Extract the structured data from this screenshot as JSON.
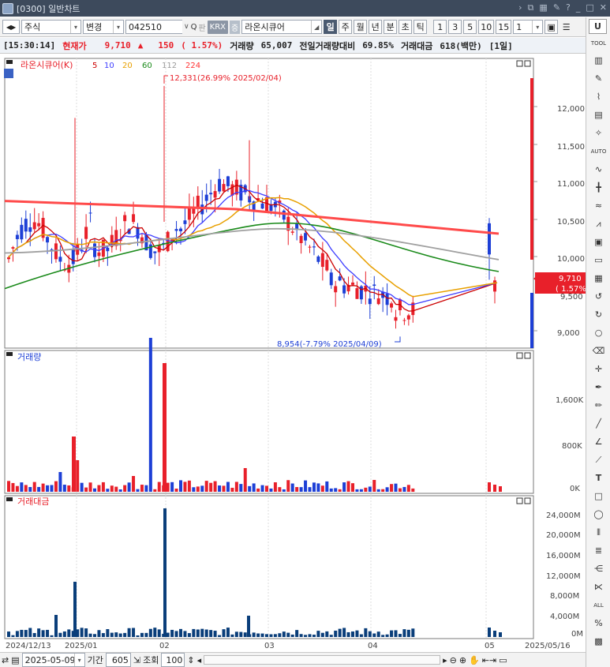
{
  "window": {
    "title": "[0300] 일반차트"
  },
  "toolbar": {
    "market": "주식",
    "mode": "변경",
    "code": "042510",
    "search": "Q",
    "kr": "판",
    "exchange": "KRX",
    "exch2": "증",
    "name": "라온시큐어",
    "periods": [
      "일",
      "주",
      "월",
      "년",
      "분",
      "초",
      "틱"
    ],
    "selected_period": "일",
    "intervals": [
      "1",
      "3",
      "5",
      "10",
      "15"
    ],
    "interval_value": "1"
  },
  "info": {
    "time": "[15:30:14]",
    "price_label": "현재가",
    "price": "9,710",
    "arrow": "▲",
    "change": "150",
    "pct": "( 1.57%)",
    "vol_label": "거래량",
    "vol": "65,007",
    "prevvol_label": "전일거래량대비",
    "prevvol": "69.85%",
    "amt_label": "거래대금",
    "amt": "618(백만)",
    "period": "[1일]"
  },
  "price_panel": {
    "legend_name": "라온시큐어(K)",
    "ma": [
      {
        "label": "5",
        "color": "#cc0000"
      },
      {
        "label": "10",
        "color": "#3d3dff"
      },
      {
        "label": "20",
        "color": "#e8a000"
      },
      {
        "label": "60",
        "color": "#1a8a1a"
      },
      {
        "label": "112",
        "color": "#9a9a9a"
      },
      {
        "label": "224",
        "color": "#ff3333"
      }
    ],
    "high_note": "12,331(26.99% 2025/02/04)",
    "low_note": "8,954(-7.79% 2025/04/09)",
    "price_tag": "9,710",
    "pct_tag": "( 1.57%)",
    "hidden_tick": "9,500",
    "yticks": [
      "12,000",
      "11,500",
      "11,000",
      "10,500",
      "10,000",
      "9,000"
    ]
  },
  "volume_panel": {
    "title": "거래량",
    "yticks": [
      "1,600K",
      "800K",
      "0K"
    ]
  },
  "amount_panel": {
    "title": "거래대금",
    "yticks": [
      "24,000M",
      "20,000M",
      "16,000M",
      "12,000M",
      "8,000M",
      "4,000M",
      "0M"
    ]
  },
  "xaxis": {
    "labels": [
      "2024/12/13",
      "2025/01",
      "02",
      "03",
      "04",
      "05",
      "2025/05/16"
    ]
  },
  "bottom": {
    "date": "2025-05-09",
    "period_label": "기간",
    "period_value": "605",
    "lookup": "조회",
    "count": "100"
  },
  "colors": {
    "up": "#e8202a",
    "down": "#1d3fd6",
    "amount": "#0a3e7a"
  }
}
